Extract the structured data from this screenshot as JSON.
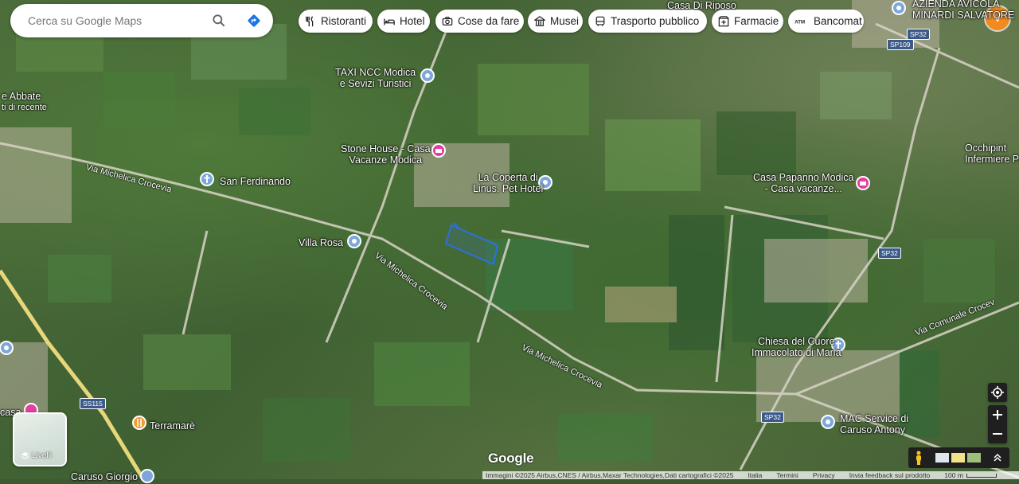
{
  "search": {
    "placeholder": "Cerca su Google Maps"
  },
  "chips": [
    {
      "label": "Ristoranti",
      "icon": "fork-knife-icon"
    },
    {
      "label": "Hotel",
      "icon": "bed-icon"
    },
    {
      "label": "Cose da fare",
      "icon": "camera-icon"
    },
    {
      "label": "Musei",
      "icon": "museum-icon"
    },
    {
      "label": "Trasporto pubblico",
      "icon": "bus-icon"
    },
    {
      "label": "Farmacie",
      "icon": "pharmacy-icon"
    },
    {
      "label": "Bancomat",
      "icon": "atm-icon"
    }
  ],
  "avatar": {
    "initial": "V",
    "color": "#f28a1e"
  },
  "places": {
    "casa_riposo": "Casa Di Riposo",
    "azienda": "AZIENDA AVICOLA",
    "azienda2": "MINARDI SALVATORE",
    "taxi1": "TAXI NCC Modica",
    "taxi2": "e Sevizi Turistici",
    "abbate1": "e Abbate",
    "abbate2": "ti di recente",
    "stone1": "Stone House - Casa",
    "stone2": "Vacanze Modica",
    "coperta1": "La Coperta di",
    "coperta2": "Linus. Pet Hotel",
    "san_ferdinando": "San Ferdinando",
    "villa_rosa": "Villa Rosa",
    "papanno1": "Casa Papanno Modica",
    "papanno2": "- Casa vacanze...",
    "occhipinti1": "Occhipint",
    "occhipinti2": "Infermiere Profes",
    "chiesa1": "Chiesa del Cuore",
    "chiesa2": "Immacolato di Maria",
    "mac1": "MAC Service di",
    "mac2": "Caruso Antony",
    "terramare": "Terramarè",
    "caruso_giorgio": "Caruso Giorgio",
    "casa_left": "casa"
  },
  "roads": {
    "michelica1": "Via Michelica Crocevia",
    "michelica2": "Via Michelica Crocevia",
    "michelica3": "Via Michelica Crocevia",
    "comunale": "Via Comunale Crocev"
  },
  "shields": {
    "sp109": "SP109",
    "sp32a": "SP32",
    "sp32b": "SP32",
    "sp32c": "SP32",
    "ss115": "SS115"
  },
  "layers": {
    "label": "Livelli"
  },
  "logo": "Google",
  "attribution": {
    "imagery": "Immagini ©2025 Airbus,CNES / Airbus,Maxar Technologies,Dati cartografici ©2025",
    "italia": "Italia",
    "termini": "Termini",
    "privacy": "Privacy",
    "feedback": "Invia feedback sul prodotto",
    "scale": "100 m"
  }
}
